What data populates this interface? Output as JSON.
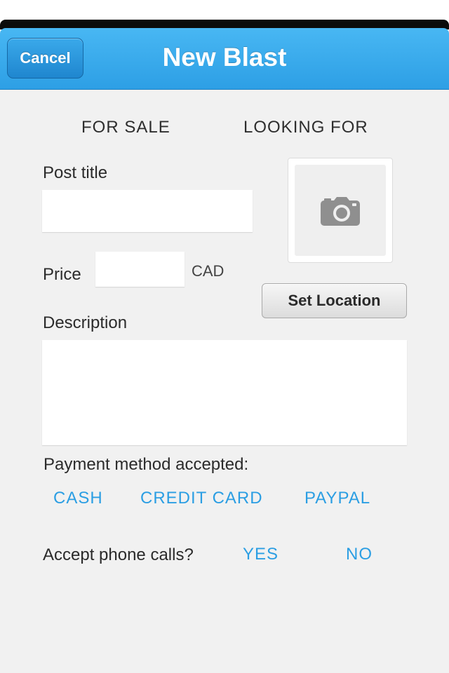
{
  "navbar": {
    "cancel_label": "Cancel",
    "title": "New Blast"
  },
  "listing_type": {
    "options": [
      "FOR SALE",
      "LOOKING FOR"
    ]
  },
  "form": {
    "post_title_label": "Post title",
    "post_title_value": "",
    "price_label": "Price",
    "price_value": "",
    "currency": "CAD",
    "description_label": "Description",
    "description_value": "",
    "photo_icon": "camera-icon",
    "set_location_label": "Set Location",
    "payment_label": "Payment method accepted:",
    "payment_options": [
      "CASH",
      "CREDIT CARD",
      "PAYPAL"
    ],
    "phone_label": "Accept phone calls?",
    "phone_options": [
      "YES",
      "NO"
    ]
  },
  "colors": {
    "accent_blue": "#2b9ee3",
    "navbar_blue": "#38aaee",
    "background": "#f1f1f1"
  }
}
